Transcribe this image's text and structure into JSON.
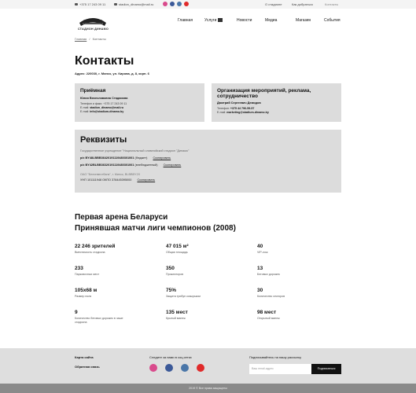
{
  "topbar": {
    "phone": "+375 17 243 09 11",
    "email": "stadion_dinamo@mail.ru",
    "links": [
      "О стадионе",
      "Как добраться",
      "Контакты"
    ],
    "social_colors": [
      "#d94a8c",
      "#3b5998",
      "#4a76a8",
      "#e02a2a"
    ]
  },
  "logo": {
    "text": "СТАДИОН ДИНАМО"
  },
  "nav": {
    "items": [
      "Главная",
      "Услуги",
      "Новости",
      "Медиа",
      "Магазин",
      "События"
    ]
  },
  "breadcrumb": {
    "home": "Главная",
    "sep": "/",
    "current": "Контакты"
  },
  "page": {
    "title": "Контакты",
    "address": "Адрес: 220030, г. Минск, ул. Кирова, д. 8, корп. 6"
  },
  "reception": {
    "title": "Приёмная",
    "name": "Юлия Вячеславовна Стадаиова",
    "phone": "Телефон и факс: +375 17 243 09 11",
    "email1_label": "E-mail:",
    "email1": "stadion_dinamo@mail.ru",
    "email2_label": "E-mail:",
    "email2": "info@stadium-dinamo.by"
  },
  "events_org": {
    "title": "Организация мероприятий, реклама, сотрудничество",
    "name": "Дмитрий Сергеевич Демидов",
    "phone_label": "Телефон:",
    "phone": "+375 44 796-59-57",
    "email_label": "E-mail:",
    "email": "marketing@stadium-dinamo.by"
  },
  "requisites": {
    "title": "Реквизиты",
    "org": "Государственное учреждение \"Национальный олимпийский стадион \"Динамо\"",
    "rows": [
      {
        "label": "р/с BY48LBBB36420191119480301001",
        "note": "(бюджет)",
        "action": "Скопировать"
      },
      {
        "label": "р/с BY42BLBB36320191119480301001",
        "note": "(внебюджетный)",
        "action": "Скопировать"
      }
    ],
    "bank": "ОАО \"Белинвестбанк\", г. Минск, BLBBBY2X",
    "unp": {
      "label": "УНП 101111948 ОКПО 378445395000",
      "action": "Скопировать"
    }
  },
  "arena": {
    "line1": "Первая арена Беларуси",
    "line2": "Принявшая матчи лиги чемпионов (2008)"
  },
  "stats": [
    {
      "value": "22 246 зрителей",
      "label": "Вместимость стадиона"
    },
    {
      "value": "47 015 м²",
      "label": "Общая площадь"
    },
    {
      "value": "40",
      "label": "VIP-лож"
    },
    {
      "value": "233",
      "label": "Парковочных мест"
    },
    {
      "value": "350",
      "label": "Прожекторов"
    },
    {
      "value": "13",
      "label": "Беговых дорожек"
    },
    {
      "value": "105х68 м",
      "label": "Размер поля"
    },
    {
      "value": "75%",
      "label": "Защита трибун козырьком"
    },
    {
      "value": "30",
      "label": "Количество секторов"
    },
    {
      "value": "9",
      "label": "Количество беговых дорожек в чаше стадиона"
    },
    {
      "value": "135 мест",
      "label": "Крытый манеж"
    },
    {
      "value": "98 мест",
      "label": "Открытый манеж"
    }
  ],
  "footer": {
    "sitemap": "Карта сайта",
    "feedback": "Обратная связь",
    "social_title": "Следите за нами в соц.сетях",
    "social_colors": [
      "#d94a8c",
      "#3b5998",
      "#4a76a8",
      "#e02a2a"
    ],
    "newsletter_title": "Подписывайтесь на нашу рассылку",
    "email_placeholder": "Ваш email-адрес",
    "subscribe_label": "Подписаться",
    "copyright": "2019 © Все права защищены"
  }
}
